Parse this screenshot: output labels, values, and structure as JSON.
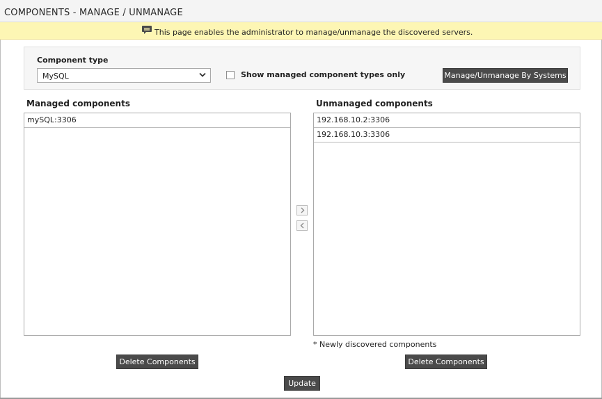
{
  "header": {
    "title": "COMPONENTS - MANAGE / UNMANAGE"
  },
  "info": {
    "icon": "speech-bubble-icon",
    "text": "This page enables the administrator to manage/unmanage the discovered servers."
  },
  "filter": {
    "component_type_label": "Component type",
    "component_type_value": "MySQL",
    "show_managed_label": "Show managed component types only",
    "show_managed_checked": false,
    "manage_by_systems_label": "Manage/Unmanage By Systems"
  },
  "managed": {
    "title": "Managed components",
    "items": [
      "mySQL:3306"
    ],
    "delete_label": "Delete Components"
  },
  "unmanaged": {
    "title": "Unmanaged components",
    "items": [
      "192.168.10.2:3306",
      "192.168.10.3:3306"
    ],
    "note": "* Newly discovered components",
    "delete_label": "Delete Components"
  },
  "actions": {
    "update_label": "Update"
  },
  "colors": {
    "info_bar": "#fdf6b4",
    "button_bg": "#4a4a4a",
    "header_bg": "#f4f4f4"
  }
}
